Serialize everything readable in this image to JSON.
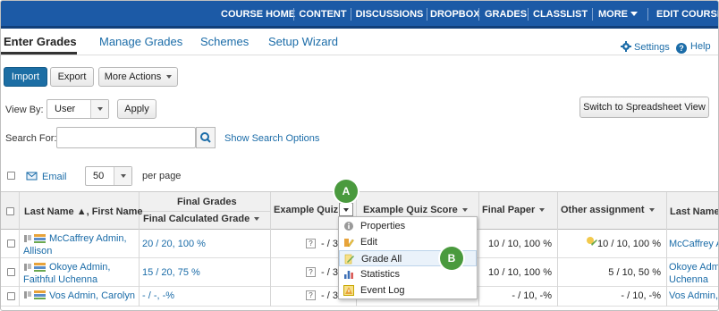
{
  "topnav": {
    "items": [
      "COURSE HOME",
      "CONTENT",
      "DISCUSSIONS",
      "DROPBOX",
      "GRADES",
      "CLASSLIST",
      "MORE",
      "EDIT COURSE"
    ]
  },
  "tabs": [
    "Enter Grades",
    "Manage Grades",
    "Schemes",
    "Setup Wizard"
  ],
  "util": {
    "settings": "Settings",
    "help": "Help"
  },
  "toolbar": {
    "import": "Import",
    "export": "Export",
    "more_actions": "More Actions"
  },
  "viewby": {
    "label": "View By:",
    "value": "User",
    "apply": "Apply"
  },
  "switch_view": "Switch to Spreadsheet View",
  "search": {
    "label": "For:",
    "label_full": "Search For:",
    "placeholder": "",
    "show_options": "Show Search Options"
  },
  "list_controls": {
    "email": "Email",
    "per_page_value": "50",
    "per_page_label": "per page"
  },
  "table": {
    "headers": {
      "name": "Last Name ▲, First Name",
      "final_grades_group": "Final Grades",
      "final_calculated": "Final Calculated Grade",
      "example_quiz": "Example Quiz",
      "example_quiz_score": "Example Quiz Score",
      "final_paper": "Final Paper",
      "other_assignment": "Other assignment",
      "last_name_right": "Last Name"
    },
    "rows": [
      {
        "name_line1": "McCaffrey Admin,",
        "name_line2": "Allison",
        "final": "20 / 20, 100 %",
        "quiz": "- / 3",
        "paper": "10 / 10, 100 %",
        "other": "10 / 10, 100 %",
        "right": "McCaffrey A"
      },
      {
        "name_line1": "Okoye Admin,",
        "name_line2": "Faithful Uchenna",
        "final": "15 / 20, 75 %",
        "quiz": "- / 3",
        "paper": "10 / 10, 100 %",
        "other": "5 / 10, 50 %",
        "right": "Okoye Admi",
        "right2": "Uchenna"
      },
      {
        "name_line1": "Vos Admin, Carolyn",
        "name_line2": "",
        "final": "- / -, -%",
        "quiz": "- / 3",
        "paper": "- / 10, -%",
        "other": "- / 10, -%",
        "right": "Vos Admin, "
      }
    ]
  },
  "menu": {
    "items": [
      "Properties",
      "Edit",
      "Grade All",
      "Statistics",
      "Event Log"
    ]
  },
  "callouts": [
    "A",
    "B"
  ],
  "colors": {
    "nav": "#1c5aa6",
    "link": "#1b6ca8",
    "callout": "#4a9a3e"
  }
}
